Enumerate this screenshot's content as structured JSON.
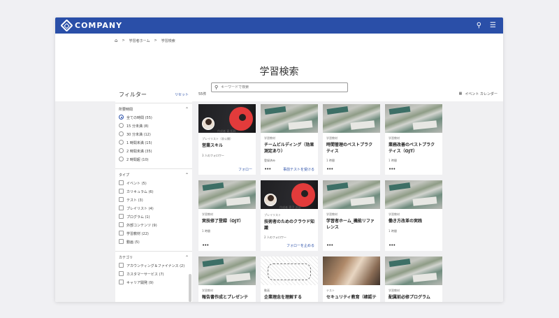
{
  "header": {
    "logo_text": "COMPANY",
    "search_icon": "search-icon",
    "menu_icon": "hamburger-menu-icon"
  },
  "breadcrumb": {
    "home_icon": "home-icon",
    "separator": ">",
    "items": [
      "学習者ホーム",
      "学習検索"
    ]
  },
  "page": {
    "title": "学習検索",
    "search_placeholder": "キーワードで検索"
  },
  "filter": {
    "title": "フィルター",
    "reset_label": "リセット",
    "sections": [
      {
        "title": "所要時間",
        "type": "radio",
        "options": [
          {
            "label": "全ての時間 (55)",
            "selected": true
          },
          {
            "label": "15 分未満 (8)",
            "selected": false
          },
          {
            "label": "30 分未満 (12)",
            "selected": false
          },
          {
            "label": "1 時間未満 (15)",
            "selected": false
          },
          {
            "label": "2 時間未満 (35)",
            "selected": false
          },
          {
            "label": "2 時間超 (10)",
            "selected": false
          }
        ]
      },
      {
        "title": "タイプ",
        "type": "checkbox",
        "options": [
          {
            "label": "イベント (5)"
          },
          {
            "label": "カリキュラム (6)"
          },
          {
            "label": "テスト (3)"
          },
          {
            "label": "プレイリスト (4)"
          },
          {
            "label": "プログラム (1)"
          },
          {
            "label": "外部コンテンツ (9)"
          },
          {
            "label": "学習教材 (22)"
          },
          {
            "label": "動画 (5)"
          }
        ]
      },
      {
        "title": "カテゴリ",
        "type": "checkbox",
        "options": [
          {
            "label": "アカウンティング＆ファイナンス (2)"
          },
          {
            "label": "カスタマーサービス (7)"
          },
          {
            "label": "キャリア開発 (9)"
          }
        ]
      }
    ]
  },
  "results": {
    "count": "55件",
    "calendar_icon": "calendar-icon",
    "calendar_label": "イベント カレンダー",
    "more_label": "•••",
    "cards": [
      {
        "thumb": "dark",
        "avatar": true,
        "author": "作成者 青 拓幹",
        "type": "プレイリスト（非公開）",
        "title": "営業スキル",
        "meta": "3 人のフォロワー",
        "action": "フォロー",
        "more": false
      },
      {
        "thumb": "books",
        "avatar": false,
        "author": "",
        "type": "学習教材",
        "title": "チームビルディング（効果測定あり）",
        "meta": "登録済み",
        "action": "事前テストを受ける",
        "more": true
      },
      {
        "thumb": "books",
        "avatar": false,
        "author": "",
        "type": "学習教材",
        "title": "時間管理のベストプラクティス",
        "meta": "1 時間",
        "action": "",
        "more": true
      },
      {
        "thumb": "books",
        "avatar": false,
        "author": "",
        "type": "学習教材",
        "title": "業務改善のベストプラクティス（OJT）",
        "meta": "1 時間",
        "action": "",
        "more": true
      },
      {
        "thumb": "books",
        "avatar": false,
        "author": "",
        "type": "学習教材",
        "title": "実技修了登録（OJT）",
        "meta": "1 時間",
        "action": "",
        "more": true
      },
      {
        "thumb": "dark",
        "avatar": true,
        "author": "作成者 恵子 浜田",
        "type": "プレイリスト",
        "title": "技術者のためのクラウド知識",
        "meta": "2 人のフォロワー",
        "action": "フォローを止める",
        "more": false
      },
      {
        "thumb": "books",
        "avatar": false,
        "author": "",
        "type": "学習教材",
        "title": "学習者ホーム_機能リファレンス",
        "meta": "",
        "action": "",
        "more": true
      },
      {
        "thumb": "books",
        "avatar": false,
        "author": "",
        "type": "学習教材",
        "title": "働き方改革の実践",
        "meta": "1 時間",
        "action": "",
        "more": true
      },
      {
        "thumb": "books",
        "avatar": false,
        "author": "",
        "type": "学習教材",
        "title": "報告書作成とプレゼンテ",
        "meta": "",
        "action": "",
        "more": false
      },
      {
        "thumb": "sketch",
        "avatar": false,
        "author": "",
        "type": "動画",
        "title": "企業理念を理解する",
        "meta": "",
        "action": "",
        "more": false
      },
      {
        "thumb": "hands",
        "avatar": false,
        "author": "",
        "type": "テスト",
        "title": "セキュリティ教育（確認テ",
        "meta": "",
        "action": "",
        "more": false
      },
      {
        "thumb": "books",
        "avatar": false,
        "author": "",
        "type": "学習教材",
        "title": "配属前必修プログラム",
        "meta": "",
        "action": "",
        "more": false
      }
    ]
  }
}
